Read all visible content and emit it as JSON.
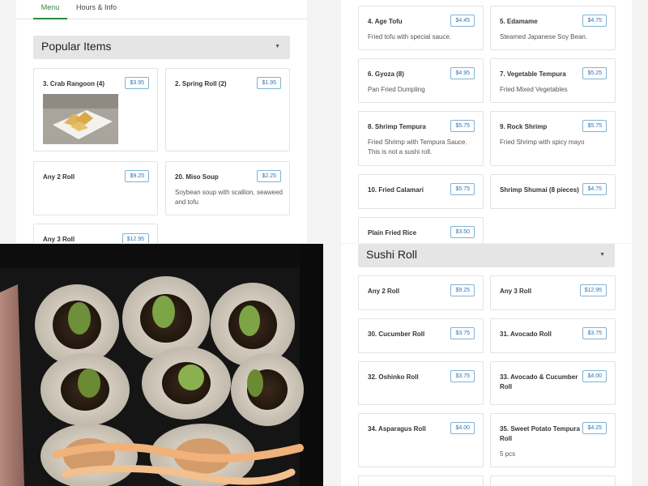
{
  "tabs": {
    "menu": "Menu",
    "hours": "Hours & Info"
  },
  "popular": {
    "title": "Popular Items",
    "items": [
      {
        "name": "3. Crab Rangoon (4)",
        "price": "$3.95",
        "desc": ""
      },
      {
        "name": "2. Spring Roll (2)",
        "price": "$1.95",
        "desc": ""
      },
      {
        "name": "Any 2 Roll",
        "price": "$9.25",
        "desc": ""
      },
      {
        "name": "20. Miso Soup",
        "price": "$2.25",
        "desc": "Soybean soup with scallion, seaweed and tofu"
      },
      {
        "name": "Any 3 Roll",
        "price": "$12.95",
        "desc": ""
      }
    ]
  },
  "appetizers": {
    "items": [
      {
        "name": "4. Age Tofu",
        "price": "$4.45",
        "desc": "Fried tofu with special sauce."
      },
      {
        "name": "5. Edamame",
        "price": "$4.75",
        "desc": "Steamed Japanese Soy Bean."
      },
      {
        "name": "6. Gyoza (8)",
        "price": "$4.95",
        "desc": "Pan Fried Dumpling"
      },
      {
        "name": "7. Vegetable Tempura",
        "price": "$5.25",
        "desc": "Fried Mixed Vegetables"
      },
      {
        "name": "8. Shrimp Tempura",
        "price": "$5.75",
        "desc": "Fried Shrimp with Tempura Sauce. This is not a sushi roll."
      },
      {
        "name": "9. Rock Shrimp",
        "price": "$5.75",
        "desc": "Fried Shrimp with spicy mayo"
      },
      {
        "name": "10. Fried Calamari",
        "price": "$5.75",
        "desc": ""
      },
      {
        "name": "Shrimp Shumai (8 pieces)",
        "price": "$4.75",
        "desc": ""
      },
      {
        "name": "Plain Fried Rice",
        "price": "$3.50",
        "desc": ""
      }
    ]
  },
  "sushi": {
    "title": "Sushi Roll",
    "items": [
      {
        "name": "Any 2 Roll",
        "price": "$9.25",
        "desc": ""
      },
      {
        "name": "Any 3 Roll",
        "price": "$12.95",
        "desc": ""
      },
      {
        "name": "30. Cucumber Roll",
        "price": "$3.75",
        "desc": ""
      },
      {
        "name": "31. Avocado Roll",
        "price": "$3.75",
        "desc": ""
      },
      {
        "name": "32. Oshinko Roll",
        "price": "$3.75",
        "desc": ""
      },
      {
        "name": "33. Avocado & Cucumber Roll",
        "price": "$4.00",
        "desc": ""
      },
      {
        "name": "34. Asparagus Roll",
        "price": "$4.00",
        "desc": ""
      },
      {
        "name": "35. Sweet Potato Tempura Roll",
        "price": "$4.25",
        "desc": "5 pcs"
      }
    ]
  },
  "icons": {
    "caret": "caret-down-icon"
  },
  "colors": {
    "accent": "#2a8a3c",
    "price": "#2f74b5",
    "header_bg": "#e5e5e5"
  }
}
